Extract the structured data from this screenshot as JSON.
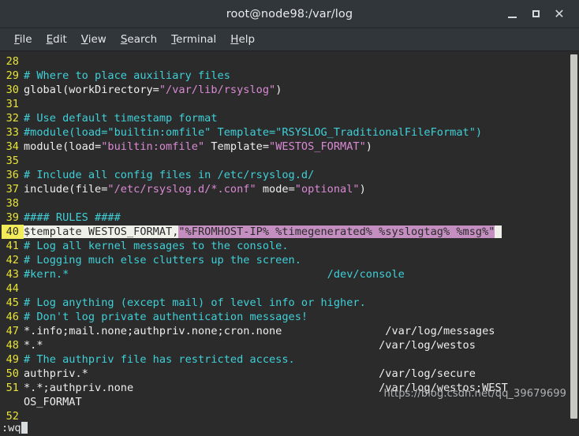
{
  "window": {
    "title": "root@node98:/var/log",
    "controls": [
      {
        "name": "minimize",
        "label": "_"
      },
      {
        "name": "maximize",
        "label": "□"
      },
      {
        "name": "close",
        "label": "✕"
      }
    ]
  },
  "menubar": {
    "items": [
      {
        "mnemonic": "F",
        "rest": "ile"
      },
      {
        "mnemonic": "E",
        "rest": "dit"
      },
      {
        "mnemonic": "V",
        "rest": "iew"
      },
      {
        "mnemonic": "S",
        "rest": "earch"
      },
      {
        "mnemonic": "T",
        "rest": "erminal"
      },
      {
        "mnemonic": "H",
        "rest": "elp"
      }
    ]
  },
  "editor": {
    "current_line": 40,
    "lines": [
      {
        "num": "28",
        "segments": []
      },
      {
        "num": "29",
        "segments": [
          {
            "t": "# Where to place auxiliary files",
            "c": "cm"
          }
        ]
      },
      {
        "num": "30",
        "segments": [
          {
            "t": "global(workDirectory=",
            "c": "tx"
          },
          {
            "t": "\"/var/lib/rsyslog\"",
            "c": "st"
          },
          {
            "t": ")",
            "c": "tx"
          }
        ]
      },
      {
        "num": "31",
        "segments": []
      },
      {
        "num": "32",
        "segments": [
          {
            "t": "# Use default timestamp format",
            "c": "cm"
          }
        ]
      },
      {
        "num": "33",
        "segments": [
          {
            "t": "#module(load=\"builtin:omfile\" Template=\"RSYSLOG_TraditionalFileFormat\")",
            "c": "cm"
          }
        ]
      },
      {
        "num": "34",
        "segments": [
          {
            "t": "module(load=",
            "c": "tx"
          },
          {
            "t": "\"builtin:omfile\"",
            "c": "st"
          },
          {
            "t": " Template=",
            "c": "tx"
          },
          {
            "t": "\"WESTOS_FORMAT\"",
            "c": "st"
          },
          {
            "t": ")",
            "c": "tx"
          }
        ]
      },
      {
        "num": "35",
        "segments": []
      },
      {
        "num": "36",
        "segments": [
          {
            "t": "# Include all config files in /etc/rsyslog.d/",
            "c": "cm"
          }
        ]
      },
      {
        "num": "37",
        "segments": [
          {
            "t": "include(file=",
            "c": "tx"
          },
          {
            "t": "\"/etc/rsyslog.d/*.conf\"",
            "c": "st"
          },
          {
            "t": " mode=",
            "c": "tx"
          },
          {
            "t": "\"optional\"",
            "c": "st"
          },
          {
            "t": ")",
            "c": "tx"
          }
        ]
      },
      {
        "num": "38",
        "segments": []
      },
      {
        "num": "39",
        "segments": [
          {
            "t": "#### RULES ####",
            "c": "cm"
          }
        ]
      },
      {
        "num": "40",
        "current": true,
        "segments": [
          {
            "t": "$template WESTOS_FORMAT,",
            "c": "seg-plain"
          },
          {
            "t": "\"%FROMHOST-IP% %timegenerated% %syslogtag% %msg%\"",
            "c": "seg-str"
          },
          {
            "t": " ",
            "c": "seg-cursor"
          }
        ]
      },
      {
        "num": "41",
        "segments": [
          {
            "t": "# Log all kernel messages to the console.",
            "c": "cm"
          }
        ]
      },
      {
        "num": "42",
        "segments": [
          {
            "t": "# Logging much else clutters up the screen.",
            "c": "cm"
          }
        ]
      },
      {
        "num": "43",
        "segments": [
          {
            "t": "#kern.*                                        /dev/console",
            "c": "cm"
          }
        ]
      },
      {
        "num": "44",
        "segments": []
      },
      {
        "num": "45",
        "segments": [
          {
            "t": "# Log anything (except mail) of level info or higher.",
            "c": "cm"
          }
        ]
      },
      {
        "num": "46",
        "segments": [
          {
            "t": "# Don't log private authentication messages!",
            "c": "cm"
          }
        ]
      },
      {
        "num": "47",
        "segments": [
          {
            "t": "*.info;mail.none;authpriv.none;cron.none                /var/log/messages",
            "c": "tx"
          }
        ]
      },
      {
        "num": "48",
        "segments": [
          {
            "t": "*.*                                                    /var/log/westos",
            "c": "tx"
          }
        ]
      },
      {
        "num": "49",
        "segments": [
          {
            "t": "# The authpriv file has restricted access.",
            "c": "cm"
          }
        ]
      },
      {
        "num": "50",
        "segments": [
          {
            "t": "authpriv.*                                             /var/log/secure",
            "c": "tx"
          }
        ]
      },
      {
        "num": "51",
        "segments": [
          {
            "t": "*.*;authpriv.none                                      /var/log/westos;WEST",
            "c": "tx"
          }
        ]
      },
      {
        "num": "",
        "wrapped": true,
        "segments": [
          {
            "t": "OS_FORMAT",
            "c": "tx"
          }
        ]
      },
      {
        "num": "52",
        "segments": []
      }
    ]
  },
  "statusline": {
    "command": ":wq"
  },
  "watermark": {
    "text": "https://blog.csdn.net/qq_39679699"
  },
  "colors": {
    "background": "#2b2b2b",
    "chrome": "#31363b",
    "line_number": "#e8e337",
    "comment": "#3fd0d8",
    "string": "#d98ad4",
    "text": "#eeeeee",
    "current_line_number_bg": "#f2ec5a",
    "current_line_bg": "#f0f0eb",
    "current_line_string_bg": "#c58ec0",
    "scrollbar": "#c9c9c4"
  }
}
